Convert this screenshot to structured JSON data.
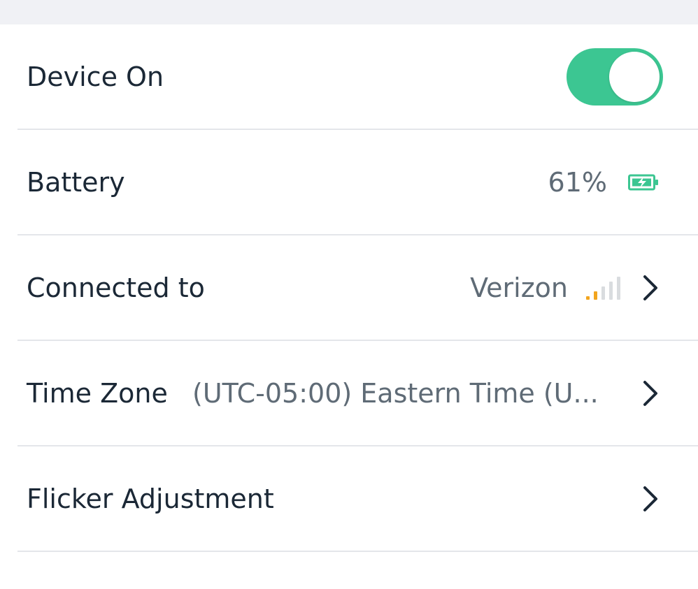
{
  "settings": {
    "device_on": {
      "label": "Device On",
      "enabled": true
    },
    "battery": {
      "label": "Battery",
      "value": "61%",
      "icon": "battery-charging-icon"
    },
    "connected_to": {
      "label": "Connected to",
      "value": "Verizon",
      "signal_bars_active": 2,
      "signal_bars_total": 5,
      "icon": "chevron-right-icon"
    },
    "time_zone": {
      "label": "Time Zone",
      "value": "(UTC-05:00) Eastern Time (U...",
      "icon": "chevron-right-icon"
    },
    "flicker_adjustment": {
      "label": "Flicker Adjustment",
      "icon": "chevron-right-icon"
    }
  },
  "colors": {
    "accent_green": "#3cc692",
    "signal_active": "#f2a51f",
    "signal_inactive": "#d9dcdf",
    "divider": "#e4e6ea",
    "text_primary": "#1b2836",
    "text_secondary": "#5f6b76",
    "top_band": "#f0f1f5"
  }
}
